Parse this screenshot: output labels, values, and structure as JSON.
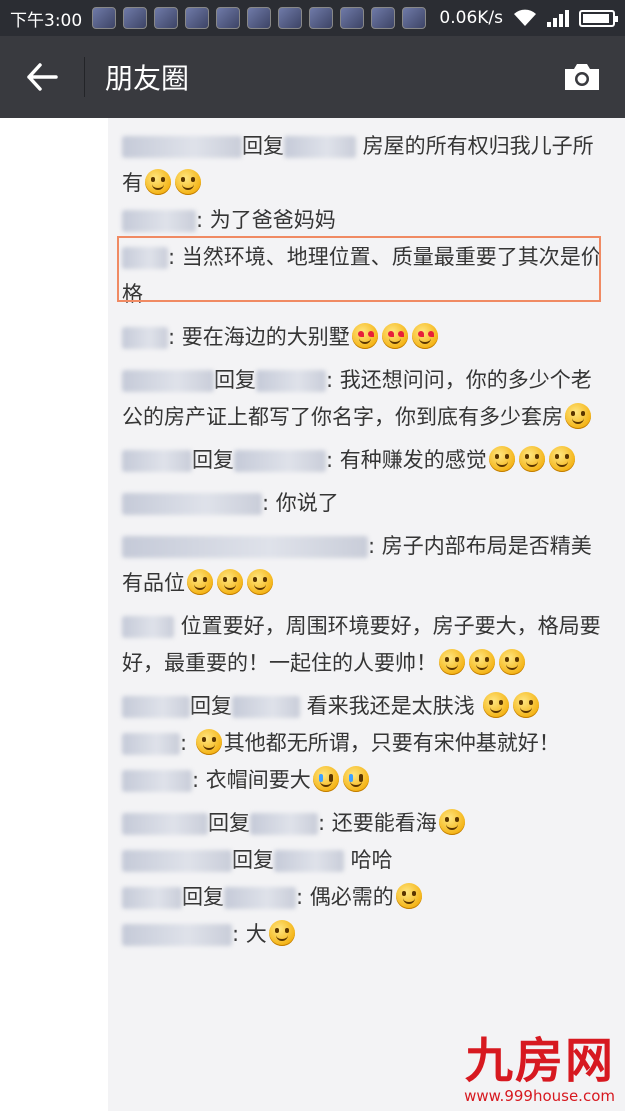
{
  "status_bar": {
    "time": "下午3:00",
    "network_speed": "0.06K/s",
    "icons": [
      "wifi-icon",
      "signal-icon",
      "battery-icon"
    ]
  },
  "header": {
    "title": "朋友圈",
    "back_icon": "back-arrow-icon",
    "camera_icon": "camera-icon"
  },
  "comments": [
    {
      "parts": [
        {
          "t": "name"
        },
        {
          "t": "reply",
          "v": "回复"
        },
        {
          "t": "name"
        },
        {
          "t": "text",
          "v": " 房屋的所有权归我儿子所有"
        },
        {
          "t": "emoji",
          "v": "thinking"
        },
        {
          "t": "emoji",
          "v": "thinking"
        }
      ]
    },
    {
      "parts": [
        {
          "t": "name"
        },
        {
          "t": "text",
          "v": ": 为了爸爸妈妈"
        }
      ]
    },
    {
      "parts": [
        {
          "t": "name"
        },
        {
          "t": "text",
          "v": ": 当然环境、地理位置、质量最重要了其次是价格"
        }
      ]
    },
    {
      "parts": [
        {
          "t": "name"
        },
        {
          "t": "text",
          "v": ": 要在海边的大别墅"
        },
        {
          "t": "emoji",
          "v": "heart-eyes"
        },
        {
          "t": "emoji",
          "v": "heart-eyes"
        },
        {
          "t": "emoji",
          "v": "heart-eyes"
        }
      ]
    },
    {
      "parts": [
        {
          "t": "name"
        },
        {
          "t": "reply",
          "v": "回复"
        },
        {
          "t": "name"
        },
        {
          "t": "text",
          "v": ": 我还想问问，你的多少个老公的房产证上都写了你名字，你到底有多少套房"
        },
        {
          "t": "emoji",
          "v": "grin"
        }
      ]
    },
    {
      "parts": [
        {
          "t": "name"
        },
        {
          "t": "reply",
          "v": "回复"
        },
        {
          "t": "name"
        },
        {
          "t": "text",
          "v": ": 有种赚发的感觉"
        },
        {
          "t": "emoji",
          "v": "thinking"
        },
        {
          "t": "emoji",
          "v": "thinking"
        },
        {
          "t": "emoji",
          "v": "thinking"
        }
      ]
    },
    {
      "parts": [
        {
          "t": "name"
        },
        {
          "t": "text",
          "v": ": 你说了"
        }
      ]
    },
    {
      "parts": [
        {
          "t": "name"
        },
        {
          "t": "text",
          "v": ": 房子内部布局是否精美有品位"
        },
        {
          "t": "emoji",
          "v": "smile"
        },
        {
          "t": "emoji",
          "v": "smile"
        },
        {
          "t": "emoji",
          "v": "smile"
        }
      ]
    },
    {
      "parts": [
        {
          "t": "name"
        },
        {
          "t": "text",
          "v": " 位置要好，周围环境要好，房子要大，格局要好，最重要的！一起住的人要帅！"
        },
        {
          "t": "emoji",
          "v": "grin"
        },
        {
          "t": "emoji",
          "v": "grin"
        },
        {
          "t": "emoji",
          "v": "grin"
        }
      ]
    },
    {
      "parts": [
        {
          "t": "name"
        },
        {
          "t": "reply",
          "v": "回复"
        },
        {
          "t": "name"
        },
        {
          "t": "text",
          "v": " 看来我还是太肤浅 "
        },
        {
          "t": "emoji",
          "v": "thinking"
        },
        {
          "t": "emoji",
          "v": "grin"
        }
      ]
    },
    {
      "parts": [
        {
          "t": "name"
        },
        {
          "t": "text",
          "v": ": "
        },
        {
          "t": "emoji",
          "v": "grimace"
        },
        {
          "t": "text",
          "v": "其他都无所谓，只要有宋仲基就好！"
        }
      ]
    },
    {
      "parts": [
        {
          "t": "name"
        },
        {
          "t": "text",
          "v": ": 衣帽间要大"
        },
        {
          "t": "emoji",
          "v": "tears"
        },
        {
          "t": "emoji",
          "v": "tears"
        }
      ]
    },
    {
      "parts": [
        {
          "t": "name"
        },
        {
          "t": "reply",
          "v": "回复"
        },
        {
          "t": "name"
        },
        {
          "t": "text",
          "v": ": 还要能看海"
        },
        {
          "t": "emoji",
          "v": "grin"
        }
      ]
    },
    {
      "parts": [
        {
          "t": "name"
        },
        {
          "t": "reply",
          "v": "回复"
        },
        {
          "t": "name"
        },
        {
          "t": "text",
          "v": " 哈哈"
        }
      ]
    },
    {
      "parts": [
        {
          "t": "name"
        },
        {
          "t": "reply",
          "v": "回复"
        },
        {
          "t": "name"
        },
        {
          "t": "text",
          "v": ": 偶必需的"
        },
        {
          "t": "emoji",
          "v": "grin"
        }
      ]
    },
    {
      "parts": [
        {
          "t": "name"
        },
        {
          "t": "text",
          "v": ": 大"
        },
        {
          "t": "emoji",
          "v": "thinking"
        }
      ]
    }
  ],
  "watermark": {
    "brand": "九房网",
    "url": "www.999house.com"
  }
}
